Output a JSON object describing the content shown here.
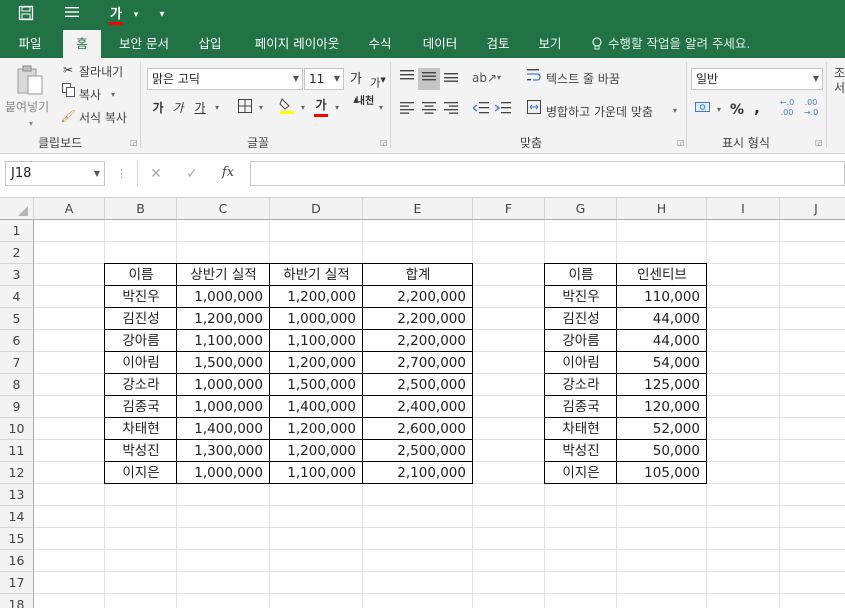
{
  "qat": {
    "save_icon": "save-icon",
    "customize_icon": "hamburger-icon",
    "font_color_glyph": "가",
    "more_glyph": "▾"
  },
  "tabs": [
    "파일",
    "홈",
    "보안 문서",
    "삽입",
    "페이지 레이아웃",
    "수식",
    "데이터",
    "검토",
    "보기"
  ],
  "active_tab": "홈",
  "tell_me": "수행할 작업을 알려 주세요.",
  "ribbon": {
    "clipboard": {
      "paste": "붙여넣기",
      "cut": "잘라내기",
      "copy": "복사",
      "format_painter": "서식 복사",
      "group": "클립보드"
    },
    "font": {
      "name": "맑은 고딕",
      "size": "11",
      "grow": "가",
      "shrink": "가",
      "bold": "가",
      "italic": "가",
      "underline": "가",
      "font_color": "가",
      "phonetic": "내천",
      "group": "글꼴"
    },
    "alignment": {
      "wrap": "텍스트 줄 바꿈",
      "merge": "병합하고 가운데 맞춤",
      "group": "맞춤"
    },
    "number": {
      "format": "일반",
      "percent": "%",
      "comma": ",",
      "inc": "←.0 .00",
      "dec": ".00 →.0",
      "group": "표시 형식"
    },
    "styles_partial": "조\n서"
  },
  "formula_bar": {
    "name_box": "J18",
    "cancel": "✕",
    "enter": "✓",
    "fx": "fx",
    "value": ""
  },
  "columns": [
    "A",
    "B",
    "C",
    "D",
    "E",
    "F",
    "G",
    "H",
    "I",
    "J"
  ],
  "rows": [
    "1",
    "2",
    "3",
    "4",
    "5",
    "6",
    "7",
    "8",
    "9",
    "10",
    "11",
    "12",
    "13",
    "14",
    "15",
    "16",
    "17",
    "18"
  ],
  "table1": {
    "headers": [
      "이름",
      "상반기 실적",
      "하반기 실적",
      "합계"
    ],
    "rows": [
      [
        "박진우",
        "1,000,000",
        "1,200,000",
        "2,200,000"
      ],
      [
        "김진성",
        "1,200,000",
        "1,000,000",
        "2,200,000"
      ],
      [
        "강아름",
        "1,100,000",
        "1,100,000",
        "2,200,000"
      ],
      [
        "이아림",
        "1,500,000",
        "1,200,000",
        "2,700,000"
      ],
      [
        "강소라",
        "1,000,000",
        "1,500,000",
        "2,500,000"
      ],
      [
        "김종국",
        "1,000,000",
        "1,400,000",
        "2,400,000"
      ],
      [
        "차태현",
        "1,400,000",
        "1,200,000",
        "2,600,000"
      ],
      [
        "박성진",
        "1,300,000",
        "1,200,000",
        "2,500,000"
      ],
      [
        "이지은",
        "1,000,000",
        "1,100,000",
        "2,100,000"
      ]
    ]
  },
  "table2": {
    "headers": [
      "이름",
      "인센티브"
    ],
    "rows": [
      [
        "박진우",
        "110,000"
      ],
      [
        "김진성",
        "44,000"
      ],
      [
        "강아름",
        "44,000"
      ],
      [
        "이아림",
        "54,000"
      ],
      [
        "강소라",
        "125,000"
      ],
      [
        "김종국",
        "120,000"
      ],
      [
        "차태현",
        "52,000"
      ],
      [
        "박성진",
        "50,000"
      ],
      [
        "이지은",
        "105,000"
      ]
    ]
  },
  "colors": {
    "excel_green": "#217346",
    "ribbon_bg": "#f3f3f3",
    "highlight_yellow": "#ffff00",
    "font_red": "#ff0000"
  }
}
